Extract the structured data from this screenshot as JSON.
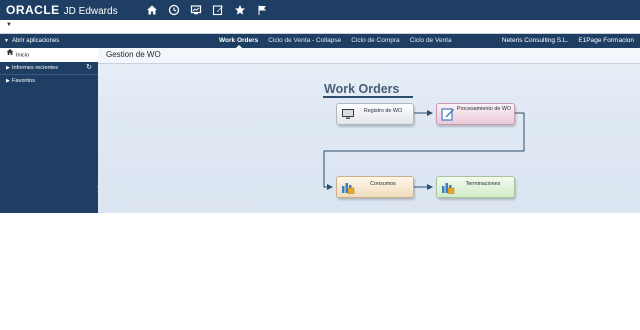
{
  "header": {
    "brand": "ORACLE",
    "product": "JD Edwards",
    "icons": [
      "home-icon",
      "recent-icon",
      "monitor-icon",
      "edit-icon",
      "star-icon",
      "flag-icon"
    ]
  },
  "nav": {
    "open_apps_label": "Abrir aplicaciones",
    "tabs": [
      {
        "label": "Work Orders",
        "active": true
      },
      {
        "label": "Ciclo de Venta - Collapse",
        "active": false
      },
      {
        "label": "Ciclo de Compra",
        "active": false
      },
      {
        "label": "Ciclo de Venta",
        "active": false
      }
    ],
    "user": "Neteris Consulting S.L.",
    "environment": "E1Page Formacion"
  },
  "sidebar": {
    "items": [
      {
        "label": "Inicio",
        "active": true,
        "icon": "home-icon"
      },
      {
        "label": "Informes recientes",
        "active": false,
        "icon": "refresh-icon"
      },
      {
        "label": "Favoritos",
        "active": false
      }
    ]
  },
  "content": {
    "page_title": "Gestion de WO",
    "diagram_title": "Work Orders",
    "nodes": {
      "registro": "Registro de WO",
      "procesamiento": "Procesamiento de WO",
      "consumos": "Consumos",
      "terminaciones": "Terminaciones"
    }
  },
  "colors": {
    "header_bg": "#1e3f63",
    "content_bg": "#dfe8f3",
    "node_pink": "#eac9d8",
    "node_orange": "#efdcbc",
    "node_green": "#d3ebc8"
  }
}
